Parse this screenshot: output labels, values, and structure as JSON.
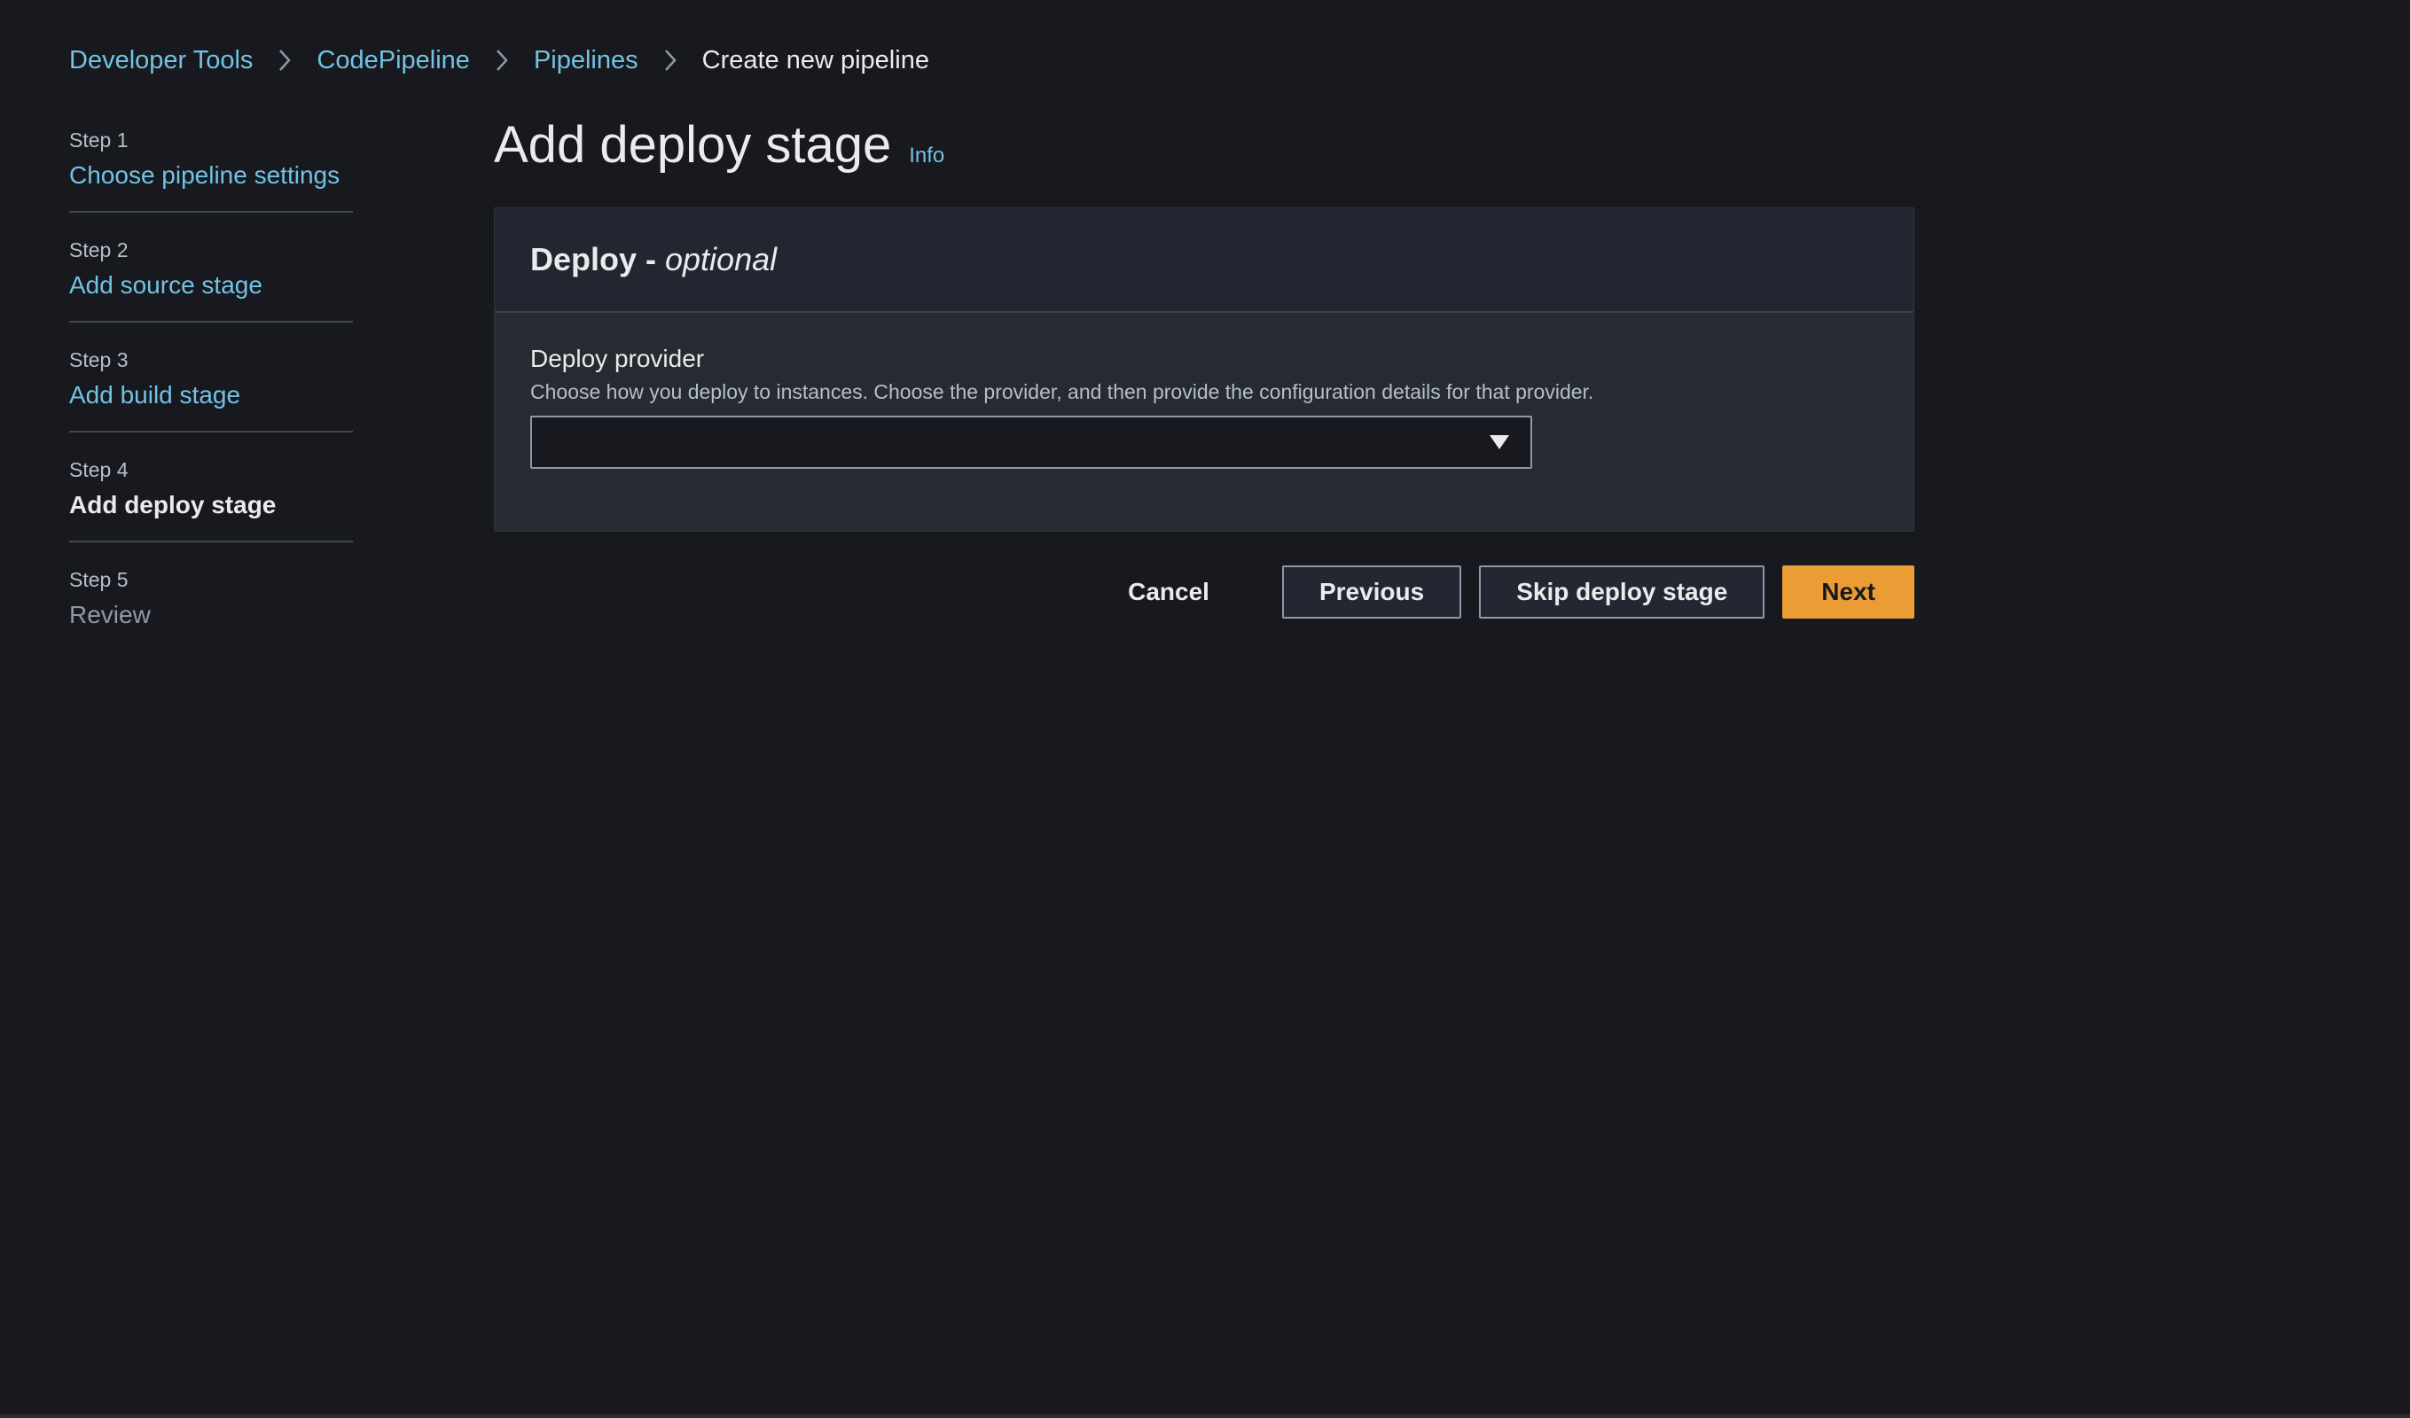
{
  "breadcrumb": {
    "items": [
      "Developer Tools",
      "CodePipeline",
      "Pipelines"
    ],
    "current": "Create new pipeline"
  },
  "steps": [
    {
      "number": "Step 1",
      "label": "Choose pipeline settings",
      "state": "completed"
    },
    {
      "number": "Step 2",
      "label": "Add source stage",
      "state": "completed"
    },
    {
      "number": "Step 3",
      "label": "Add build stage",
      "state": "completed"
    },
    {
      "number": "Step 4",
      "label": "Add deploy stage",
      "state": "current"
    },
    {
      "number": "Step 5",
      "label": "Review",
      "state": "disabled"
    }
  ],
  "main": {
    "title": "Add deploy stage",
    "info_label": "Info"
  },
  "container": {
    "title": "Deploy - ",
    "title_optional": "optional",
    "deploy_provider": {
      "label": "Deploy provider",
      "description": "Choose how you deploy to instances. Choose the provider, and then provide the configuration details for that provider.",
      "value": ""
    }
  },
  "actions": {
    "cancel": "Cancel",
    "previous": "Previous",
    "skip": "Skip deploy stage",
    "next": "Next"
  },
  "colors": {
    "background": "#18191e",
    "link": "#72c2e4",
    "primary": "#ec9c35"
  },
  "icons": {
    "separator": "chevron-right-icon",
    "caret": "caret-down-icon"
  }
}
